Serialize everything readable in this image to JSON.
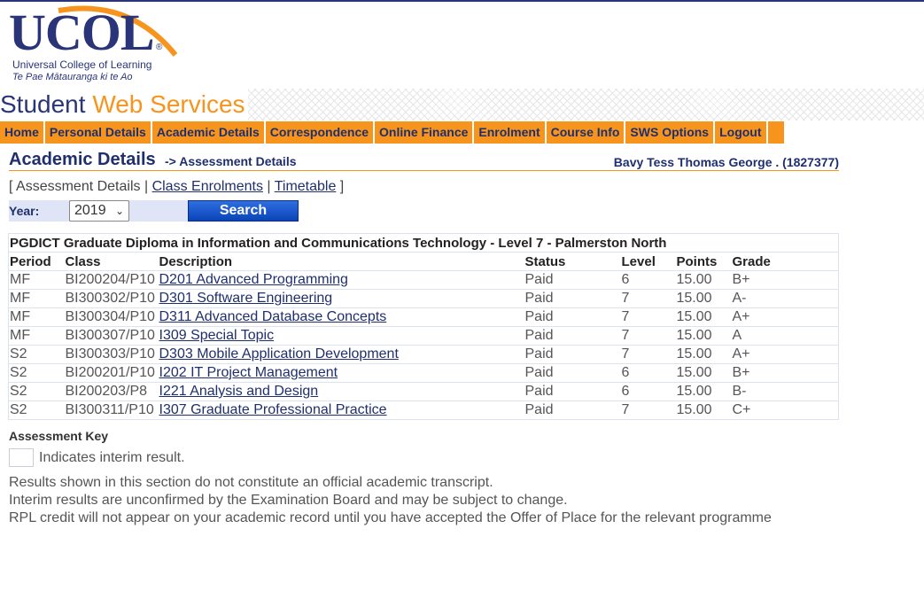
{
  "logo": {
    "word": "UCOL",
    "reg": "®",
    "line1": "Universal College of Learning",
    "line2": "Te Pae Mātauranga ki te Ao"
  },
  "banner": {
    "word1": "Student",
    "word2": "Web Services"
  },
  "nav": [
    "Home",
    "Personal Details",
    "Academic Details",
    "Correspondence",
    "Online Finance",
    "Enrolment",
    "Course Info",
    "SWS Options",
    "Logout"
  ],
  "heading": {
    "main": "Academic Details",
    "sub": "-> Assessment Details",
    "student": "Bavy Tess Thomas George . (1827377)"
  },
  "sublinks": {
    "current": "Assessment Details",
    "link1": "Class Enrolments",
    "link2": "Timetable"
  },
  "year": {
    "label": "Year:",
    "value": "2019",
    "search": "Search"
  },
  "table": {
    "programme": "PGDICT  Graduate Diploma in Information and Communications Technology - Level 7 - Palmerston North",
    "columns": [
      "Period",
      "Class",
      "Description",
      "Status",
      "Level",
      "Points",
      "Grade"
    ],
    "rows": [
      [
        "MF",
        "BI200204/P10",
        "D201 Advanced Programming",
        "Paid",
        "6",
        "15.00",
        "B+"
      ],
      [
        "MF",
        "BI300302/P10",
        "D301 Software Engineering",
        "Paid",
        "7",
        "15.00",
        "A-"
      ],
      [
        "MF",
        "BI300304/P10",
        "D311 Advanced Database Concepts",
        "Paid",
        "7",
        "15.00",
        "A+"
      ],
      [
        "MF",
        "BI300307/P10",
        "I309 Special Topic",
        "Paid",
        "7",
        "15.00",
        "A"
      ],
      [
        "S2",
        "BI300303/P10",
        "D303 Mobile Application Development",
        "Paid",
        "7",
        "15.00",
        "A+"
      ],
      [
        "S2",
        "BI200201/P10",
        "I202 IT Project Management",
        "Paid",
        "6",
        "15.00",
        "B+"
      ],
      [
        "S2",
        "BI200203/P8",
        "I221 Analysis and Design",
        "Paid",
        "6",
        "15.00",
        "B-"
      ],
      [
        "S2",
        "BI300311/P10",
        "I307 Graduate Professional Practice",
        "Paid",
        "7",
        "15.00",
        "C+"
      ]
    ]
  },
  "key": {
    "title": "Assessment Key",
    "interim": "Indicates interim result."
  },
  "notes": [
    "Results shown in this section do not constitute an official academic transcript.",
    "Interim results are unconfirmed by the Examination Board and may be subject to change.",
    "RPL credit will not appear on your academic record until you have accepted the Offer of Place for the relevant programme"
  ],
  "colors": {
    "navy": "#2a3579",
    "orange": "#f7941d"
  }
}
